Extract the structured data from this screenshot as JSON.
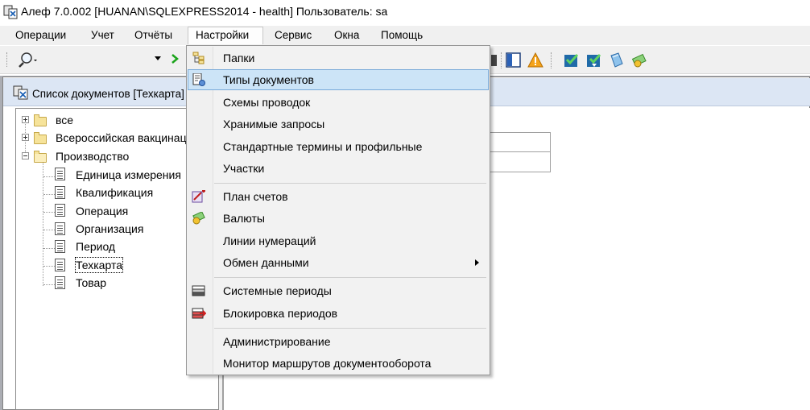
{
  "window": {
    "title": "Алеф 7.0.002 [HUANAN\\SQLEXPRESS2014 - health] Пользователь: sa"
  },
  "menubar": {
    "items": [
      {
        "label": "Операции"
      },
      {
        "label": "Учет"
      },
      {
        "label": "Отчёты"
      },
      {
        "label": "Настройки"
      },
      {
        "label": "Сервис"
      },
      {
        "label": "Окна"
      },
      {
        "label": "Помощь"
      }
    ]
  },
  "toolbar": {
    "search_icon": "magnifier-icon",
    "dropdown_arrow": "▾",
    "go_icon": "green-arrow-icon",
    "right_icons": [
      "window-icon",
      "panel-icon",
      "warning-icon",
      "check-icon",
      "check-download-icon",
      "book-icon",
      "coins-icon"
    ]
  },
  "child_window": {
    "title": "Список документов [Техкарта]"
  },
  "tree": {
    "nodes": [
      {
        "label": "все",
        "expander": "plus"
      },
      {
        "label": "Всероссийская вакцинация",
        "expander": "plus"
      },
      {
        "label": "Производство",
        "expander": "minus"
      },
      {
        "label": "Единица измерения"
      },
      {
        "label": "Квалификация"
      },
      {
        "label": "Операция"
      },
      {
        "label": "Организация"
      },
      {
        "label": "Период"
      },
      {
        "label": "Техкарта"
      },
      {
        "label": "Товар"
      }
    ]
  },
  "dropdown": {
    "items": [
      {
        "label": "Папки",
        "icon": "folder-tree-icon"
      },
      {
        "label": "Типы документов",
        "icon": "document-settings-icon"
      },
      {
        "label": "Схемы проводок"
      },
      {
        "label": "Хранимые запросы"
      },
      {
        "label": "Стандартные термины и профильные"
      },
      {
        "label": "Участки"
      },
      {
        "label": "План счетов",
        "icon": "chart-of-accounts-icon"
      },
      {
        "label": "Валюты",
        "icon": "coins-icon"
      },
      {
        "label": "Линии нумераций"
      },
      {
        "label": "Обмен данными"
      },
      {
        "label": "Системные периоды",
        "icon": "system-periods-icon"
      },
      {
        "label": "Блокировка периодов",
        "icon": "lock-periods-icon"
      },
      {
        "label": "Администрирование"
      },
      {
        "label": "Монитор маршрутов документооборота"
      }
    ]
  },
  "colors": {
    "highlight": "#cce4f7",
    "highlight_border": "#77a9d9",
    "child_title_bg": "#dce6f4"
  }
}
